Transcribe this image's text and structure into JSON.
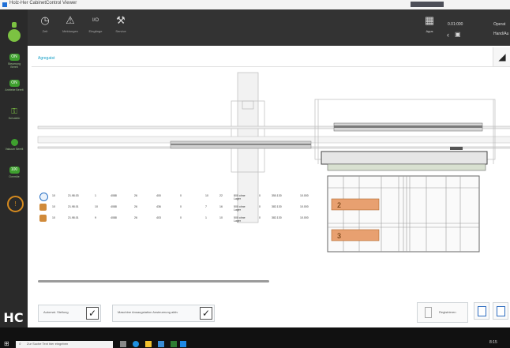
{
  "window": {
    "title": "Holz-Her CabinetControl Viewer"
  },
  "toolbar": {
    "buttons": [
      {
        "icon": "clock-icon",
        "label": "Zeit"
      },
      {
        "icon": "warning-icon",
        "label": "Meldungen"
      },
      {
        "icon": "io-icon",
        "label": "Eingänge"
      },
      {
        "icon": "tool-icon",
        "label": "Service"
      }
    ],
    "right": {
      "apps_label": "Apps",
      "status_top": "0.01:000",
      "user_top": "Operat",
      "user_bottom": "Hand/Au"
    }
  },
  "left_status": [
    {
      "badge": "ON",
      "caption": "Steuerung Bereit"
    },
    {
      "badge": "ON",
      "caption": "Antriebe Bereit"
    },
    {
      "badge": "",
      "caption": "Schutztür"
    },
    {
      "badge": "",
      "caption": "Vakuum Bereit"
    },
    {
      "badge": "100",
      "caption": "Override"
    }
  ],
  "tab": {
    "label": "Agregatst"
  },
  "table": {
    "rows": [
      {
        "icon_color": "#2a72c4",
        "cells": [
          "10",
          "21.98.03",
          "1",
          "4088",
          "26",
          "400",
          "0",
          "10",
          "22",
          "800 ohne Lager",
          "0",
          "350.130",
          "10.000"
        ]
      },
      {
        "icon_color": "#d08a3a",
        "cells": [
          "10",
          "21.98.01",
          "10",
          "4088",
          "26",
          "436",
          "0",
          "7",
          "16",
          "500 ohne Lager",
          "0",
          "382.130",
          "10.000"
        ]
      },
      {
        "icon_color": "#d08a3a",
        "cells": [
          "10",
          "21.98.01",
          "9",
          "4088",
          "26",
          "403",
          "0",
          "1",
          "10",
          "500 ohne Lager",
          "0",
          "382.130",
          "10.000"
        ]
      }
    ]
  },
  "diagram": {
    "marker_1": "2",
    "marker_2": "3"
  },
  "bottom": {
    "check1_label": "Automat. Stellung",
    "check1_checked": "✓",
    "check2_label": "Maschine Ansaugstation Ansteuerung aktiv",
    "check2_checked": "✓",
    "register_label": "Registrieren"
  },
  "taskbar": {
    "search_placeholder": "Zur Suche Text hier eingeben",
    "clock": "8:15"
  }
}
